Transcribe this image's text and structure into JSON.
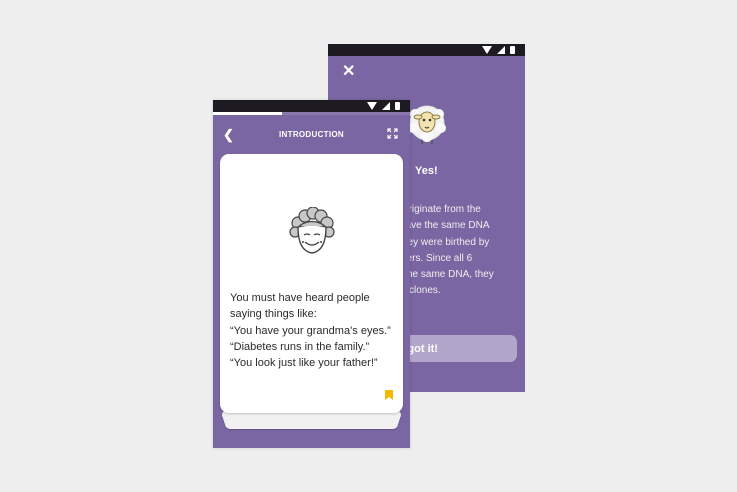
{
  "colors": {
    "page_background": "#eeeeef",
    "app_purple": "#7a66a2",
    "status_bar": "#1d1b21",
    "button_lavender": "#b2a6cb",
    "bookmark_yellow": "#f5b800"
  },
  "back_screen": {
    "close_icon": "close-icon",
    "mascot_icon": "sheep-icon",
    "title": "Yes!",
    "body_lines": [
      "originate from the",
      "have the same DNA",
      "hey were birthed by",
      "hers. Since all 6",
      "he same DNA, they",
      "clones."
    ],
    "button_label": "y, got it!"
  },
  "front_screen": {
    "header": {
      "back_icon": "chevron-left-icon",
      "title": "INTRODUCTION",
      "expand_icon": "fullscreen-icon"
    },
    "progress_fraction": 0.35,
    "card": {
      "illustration_icon": "grandma-face-icon",
      "text_lines": [
        "You must have heard people",
        "saying things like:",
        "“You have your grandma’s eyes.”",
        "“Diabetes runs in the family.”",
        "“You look just like your father!”"
      ],
      "bookmark_icon": "bookmark-icon"
    }
  }
}
